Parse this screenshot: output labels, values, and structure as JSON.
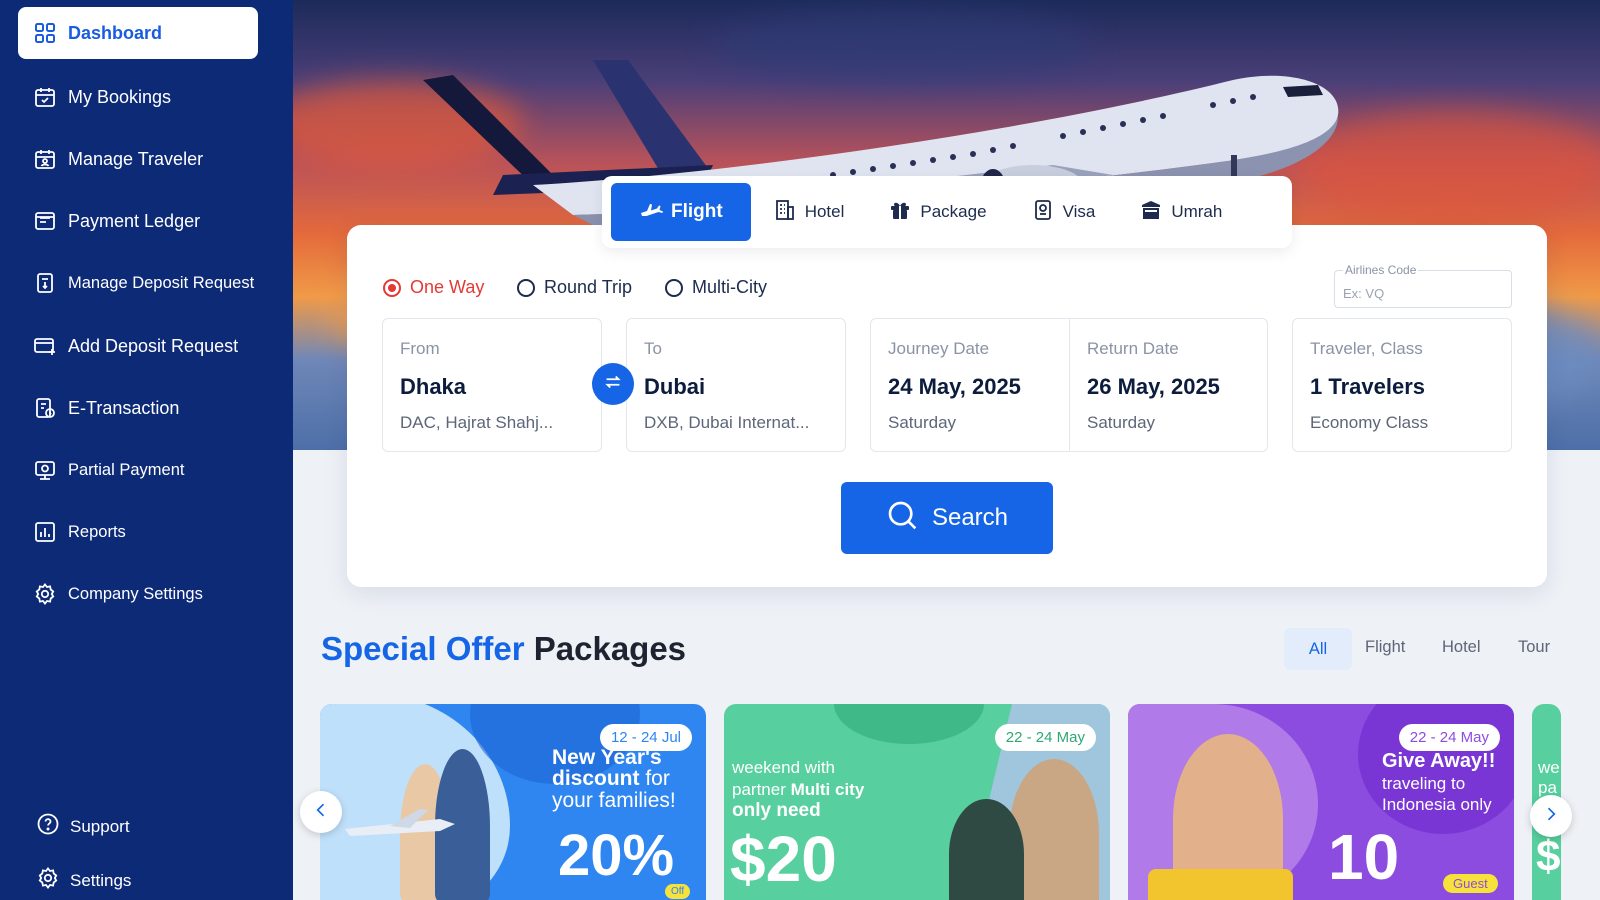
{
  "sidebar": {
    "items": [
      {
        "label": "Dashboard",
        "icon": "grid-icon",
        "active": true
      },
      {
        "label": "My Bookings",
        "icon": "calendar-check-icon"
      },
      {
        "label": "Manage Traveler",
        "icon": "calendar-user-icon"
      },
      {
        "label": "Payment Ledger",
        "icon": "ledger-icon"
      },
      {
        "label": "Manage Deposit Request",
        "icon": "deposit-icon"
      },
      {
        "label": "Add Deposit Request",
        "icon": "card-add-icon"
      },
      {
        "label": "E-Transaction",
        "icon": "e-transaction-icon"
      },
      {
        "label": "Partial Payment",
        "icon": "partial-payment-icon"
      },
      {
        "label": "Reports",
        "icon": "reports-icon"
      },
      {
        "label": "Company Settings",
        "icon": "gear-icon"
      }
    ],
    "bottom": [
      {
        "label": "Support",
        "icon": "help-icon"
      },
      {
        "label": "Settings",
        "icon": "gear-icon"
      }
    ]
  },
  "tabs": [
    {
      "label": "Flight",
      "icon": "plane-icon",
      "active": true
    },
    {
      "label": "Hotel",
      "icon": "building-icon"
    },
    {
      "label": "Package",
      "icon": "gift-icon"
    },
    {
      "label": "Visa",
      "icon": "passport-icon"
    },
    {
      "label": "Umrah",
      "icon": "kaaba-icon"
    }
  ],
  "search": {
    "trip_types": [
      {
        "label": "One Way",
        "selected": true
      },
      {
        "label": "Round Trip",
        "selected": false
      },
      {
        "label": "Multi-City",
        "selected": false
      }
    ],
    "airline": {
      "label": "Airlines Code",
      "placeholder": "Ex: VQ"
    },
    "from": {
      "label": "From",
      "city": "Dhaka",
      "airport": "DAC, Hajrat Shahj..."
    },
    "to": {
      "label": "To",
      "city": "Dubai",
      "airport": "DXB, Dubai Internat..."
    },
    "journey": {
      "label": "Journey Date",
      "date": "24 May, 2025",
      "day": "Saturday"
    },
    "return": {
      "label": "Return Date",
      "date": "26 May, 2025",
      "day": "Saturday"
    },
    "traveler": {
      "label": "Traveler, Class",
      "count": "1 Travelers",
      "class": "Economy Class"
    },
    "button": "Search"
  },
  "offers": {
    "title_highlight": "Special Offer",
    "title_rest": "Packages",
    "filters": [
      "All",
      "Flight",
      "Hotel",
      "Tour"
    ],
    "active_filter": "All",
    "cards": [
      {
        "date": "12 - 24 Jul",
        "line1": "New Year's",
        "line2": "discount",
        "line2b": "for",
        "line3": "your families!",
        "big": "20%",
        "badge": "Off",
        "color": "#2f86f0"
      },
      {
        "date": "22 - 24 May",
        "line1": "weekend with",
        "line2a": "partner",
        "line2b": "Multi city",
        "line3": "only need",
        "big": "$20",
        "color": "#57cf9e"
      },
      {
        "date": "22 - 24 May",
        "line1": "Give Away!!",
        "line2": "traveling to",
        "line3": "Indonesia only",
        "big": "10",
        "badge": "Guest",
        "color": "#8d4ce0"
      }
    ],
    "peek_text": "we pa",
    "peek_big": "$"
  },
  "colors": {
    "sidebar": "#0d2a77",
    "accent": "#1565e6",
    "selected_radio": "#e53935"
  }
}
